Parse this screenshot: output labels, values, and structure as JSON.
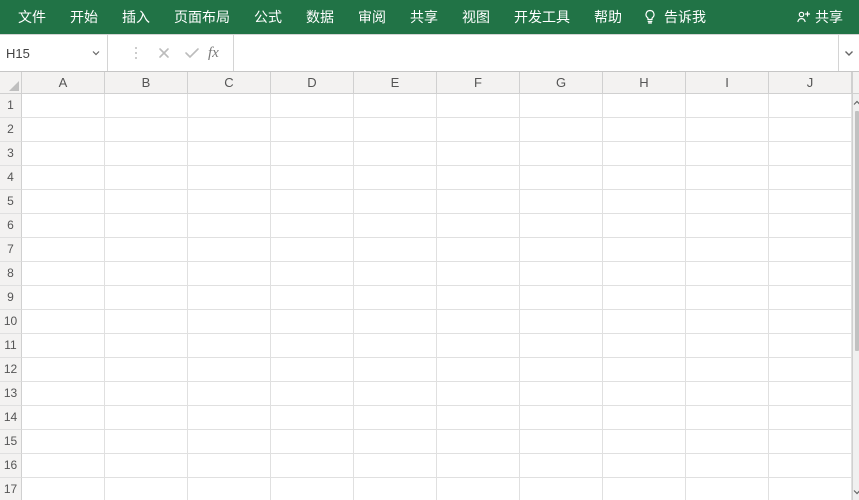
{
  "ribbon": {
    "tabs": [
      {
        "label": "文件"
      },
      {
        "label": "开始"
      },
      {
        "label": "插入"
      },
      {
        "label": "页面布局"
      },
      {
        "label": "公式"
      },
      {
        "label": "数据"
      },
      {
        "label": "审阅"
      },
      {
        "label": "共享"
      },
      {
        "label": "视图"
      },
      {
        "label": "开发工具"
      },
      {
        "label": "帮助"
      }
    ],
    "tell_me_icon": "lightbulb",
    "tell_me_label": "告诉我",
    "share_icon": "person-share",
    "share_label": "共享"
  },
  "formula_bar": {
    "name_box_value": "H15",
    "cancel_icon": "x",
    "confirm_icon": "check",
    "fx_label": "fx",
    "formula_value": ""
  },
  "grid": {
    "columns": [
      "A",
      "B",
      "C",
      "D",
      "E",
      "F",
      "G",
      "H",
      "I",
      "J"
    ],
    "rows": [
      "1",
      "2",
      "3",
      "4",
      "5",
      "6",
      "7",
      "8",
      "9",
      "10",
      "11",
      "12",
      "13",
      "14",
      "15",
      "16",
      "17"
    ]
  }
}
